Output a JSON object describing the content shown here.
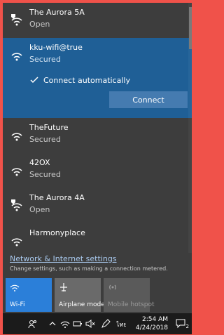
{
  "networks": [
    {
      "name": "The Aurora 5A",
      "status": "Open",
      "secure": false
    },
    {
      "name": "kku-wifi@true",
      "status": "Secured",
      "secure": true,
      "selected": true,
      "connect_automatically": "Connect automatically",
      "connect_button": "Connect"
    },
    {
      "name": "TheFuture",
      "status": "Secured",
      "secure": true
    },
    {
      "name": "42OX",
      "status": "Secured",
      "secure": true
    },
    {
      "name": "The Aurora 4A",
      "status": "Open",
      "secure": false
    },
    {
      "name": "Harmonyplace",
      "status": "",
      "secure": true
    }
  ],
  "settings": {
    "link": "Network & Internet settings",
    "description": "Change settings, such as making a connection metered."
  },
  "quick_actions": [
    {
      "label": "Wi-Fi",
      "icon": "wifi-icon",
      "state": "on"
    },
    {
      "label": "Airplane mode",
      "icon": "airplane-icon",
      "state": "off"
    },
    {
      "label": "Mobile hotspot",
      "icon": "hotspot-icon",
      "state": "disabled"
    }
  ],
  "taskbar": {
    "time": "2:54 AM",
    "date": "4/24/2018",
    "notification_count": "2",
    "icons": [
      "people-icon",
      "chevron-up-icon",
      "wifi-icon",
      "battery-icon",
      "volume-mute-icon",
      "pen-icon",
      "keyboard-language-icon"
    ]
  },
  "colors": {
    "accent": "#1f5f96",
    "tile_on": "#2b7fd9",
    "flyout_bg": "#3d3d3d",
    "border": "#f0524a"
  }
}
